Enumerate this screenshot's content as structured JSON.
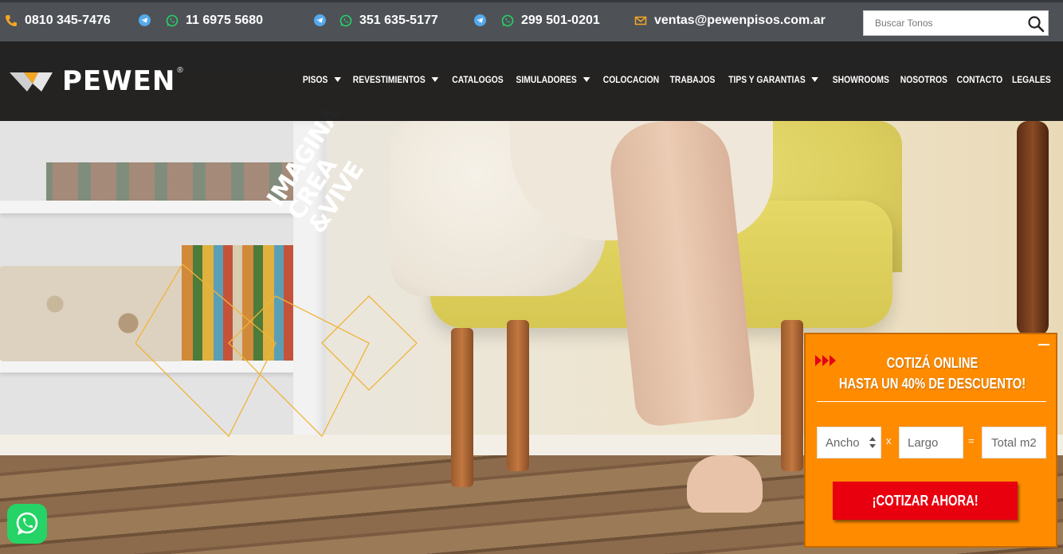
{
  "topbar": {
    "phone_main": "0810 345-7476",
    "whatsapp_1": "11 6975 5680",
    "whatsapp_2": "351 635-5177",
    "whatsapp_3": "299 501-0201",
    "email": "ventas@pewenpisos.com.ar",
    "search_placeholder": "Buscar Tonos"
  },
  "brand": {
    "name": "PEWEN",
    "reg": "®"
  },
  "nav": [
    {
      "label": "PISOS",
      "dropdown": true
    },
    {
      "label": "REVESTIMIENTOS",
      "dropdown": true
    },
    {
      "label": "CATALOGOS",
      "dropdown": false
    },
    {
      "label": "SIMULADORES",
      "dropdown": true
    },
    {
      "label": "COLOCACION",
      "dropdown": false
    },
    {
      "label": "TRABAJOS",
      "dropdown": false
    },
    {
      "label": "TIPS Y GARANTIAS",
      "dropdown": true
    },
    {
      "label": "SHOWROOMS",
      "dropdown": false
    },
    {
      "label": "NOSOTROS",
      "dropdown": false
    },
    {
      "label": "CONTACTO",
      "dropdown": false
    },
    {
      "label": "LEGALES",
      "dropdown": false
    }
  ],
  "hero": {
    "slogan": [
      "IMAGINA",
      "CREA",
      "&VIVE"
    ]
  },
  "quote": {
    "title_line1": "COTIZÁ ONLINE",
    "title_line2": "HASTA UN 40% DE DESCUENTO!",
    "width_placeholder": "Ancho",
    "length_placeholder": "Largo",
    "total_placeholder": "Total m2",
    "times_sign": "x",
    "equals_sign": "=",
    "button_label": "¡COTIZAR AHORA!"
  },
  "colors": {
    "topbar_bg": "#4e5257",
    "accent_orange": "#ff8c00",
    "button_red": "#e8000f",
    "icon_yellow": "#f5a623",
    "whatsapp_green": "#25d366",
    "telegram_blue": "#54a9eb"
  }
}
